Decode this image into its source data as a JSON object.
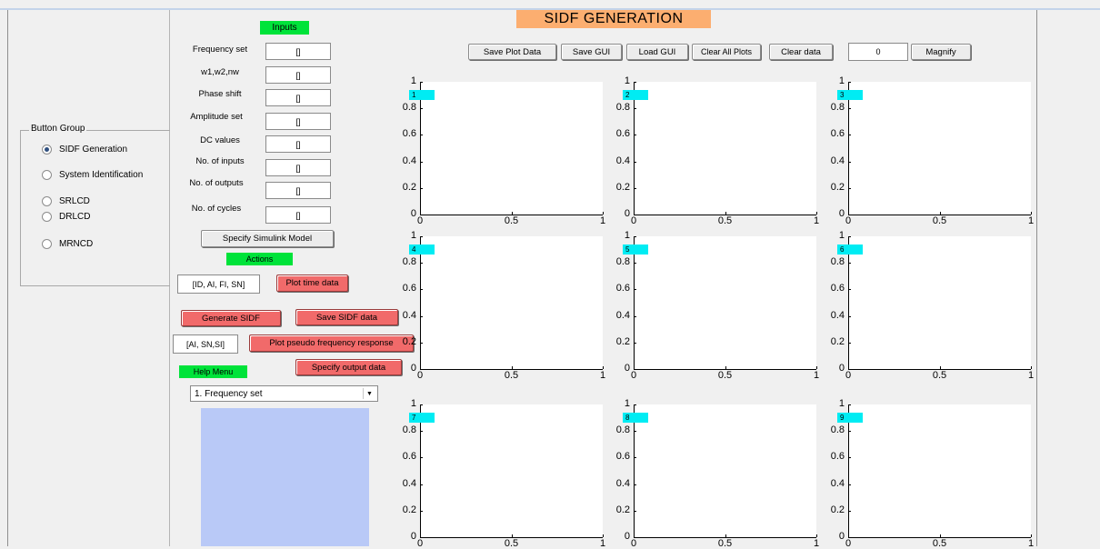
{
  "window": {
    "title": "SIDF GENERATION"
  },
  "button_group": {
    "title": "Button Group",
    "options": [
      {
        "label": "SIDF Generation",
        "selected": true
      },
      {
        "label": "System Identification",
        "selected": false
      },
      {
        "label": "SRLCD",
        "selected": false
      },
      {
        "label": "DRLCD",
        "selected": false
      },
      {
        "label": "MRNCD",
        "selected": false
      }
    ]
  },
  "inputs": {
    "header": "Inputs",
    "rows": [
      {
        "label": "Frequency set",
        "value": "[]"
      },
      {
        "label": "w1,w2,nw",
        "value": "[]"
      },
      {
        "label": "Phase shift",
        "value": "[]"
      },
      {
        "label": "Amplitude set",
        "value": "[]"
      },
      {
        "label": "DC values",
        "value": "[]"
      },
      {
        "label": "No. of inputs",
        "value": "[]"
      },
      {
        "label": "No. of outputs",
        "value": "[]"
      },
      {
        "label": "No. of cycles",
        "value": "[]"
      }
    ],
    "specify_model": "Specify Simulink Model"
  },
  "actions": {
    "header": "Actions",
    "field1": "[ID, AI, FI, SN]",
    "plot_time": "Plot time data",
    "generate": "Generate SIDF",
    "save_sidf": "Save SIDF data",
    "field2": "[AI, SN,SI]",
    "plot_pseudo": "Plot pseudo frequency response",
    "specify_output": "Specify output data"
  },
  "help": {
    "header": "Help Menu",
    "selected": "1. Frequency set"
  },
  "toolbar": {
    "save_plot": "Save Plot Data",
    "save_gui": "Save GUI",
    "load_gui": "Load GUI",
    "clear_all": "Clear All Plots",
    "clear_data": "Clear data",
    "magnify_value": "0",
    "magnify": "Magnify"
  },
  "plots": {
    "badges": [
      "1",
      "2",
      "3",
      "4",
      "5",
      "6",
      "7",
      "8",
      "9"
    ],
    "yticks": [
      "0",
      "0.2",
      "0.4",
      "0.6",
      "0.8",
      "1"
    ],
    "xticks": [
      "0",
      "0.5",
      "1"
    ]
  },
  "colors": {
    "green_tag": "#00e33a",
    "title_tag": "#fcae70",
    "red_button": "#f16a6a",
    "plot_badge": "#00ecf3",
    "help_area": "#b9c9f7"
  }
}
